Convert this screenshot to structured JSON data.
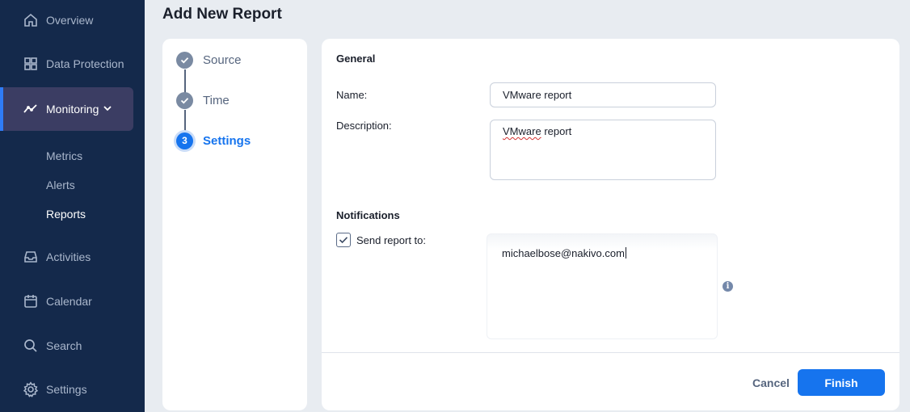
{
  "sidebar": {
    "items": [
      {
        "label": "Overview",
        "icon": "home-icon"
      },
      {
        "label": "Data Protection",
        "icon": "grid-icon"
      },
      {
        "label": "Monitoring",
        "icon": "activity-line-icon"
      },
      {
        "label": "Activities",
        "icon": "inbox-icon"
      },
      {
        "label": "Calendar",
        "icon": "calendar-icon"
      },
      {
        "label": "Search",
        "icon": "search-icon"
      },
      {
        "label": "Settings",
        "icon": "gear-icon"
      }
    ],
    "subitems": [
      {
        "label": "Metrics"
      },
      {
        "label": "Alerts"
      },
      {
        "label": "Reports"
      }
    ]
  },
  "header": {
    "title": "Add New Report"
  },
  "steps": [
    {
      "label": "Source",
      "status": "done"
    },
    {
      "label": "Time",
      "status": "done"
    },
    {
      "label": "Settings",
      "number": "3",
      "status": "active"
    }
  ],
  "form": {
    "general_title": "General",
    "name_label": "Name:",
    "name_value": "VMware report",
    "description_label": "Description:",
    "description_value": "report",
    "description_misspelled": "VMware",
    "notifications_title": "Notifications",
    "send_label": "Send report to:",
    "send_checked": true,
    "email_value": "michaelbose@nakivo.com",
    "info_icon_glyph": "i"
  },
  "actions": {
    "cancel": "Cancel",
    "finish": "Finish"
  },
  "colors": {
    "sidebar_bg": "#14294b",
    "accent": "#1674ee",
    "active_nav_bg": "#3b3d63"
  }
}
